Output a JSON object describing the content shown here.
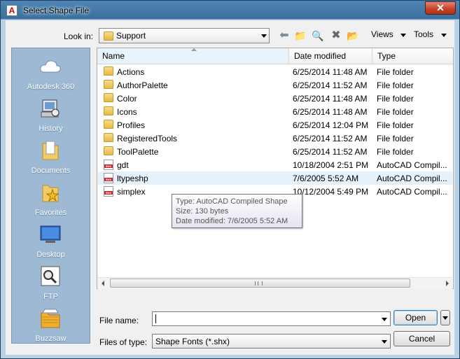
{
  "window": {
    "title": "Select Shape File",
    "app_icon": "A"
  },
  "toolbar": {
    "look_in_label": "Look in:",
    "look_in_value": "Support",
    "views_label": "Views",
    "tools_label": "Tools",
    "icons": [
      "back-icon",
      "up-folder-icon",
      "search-web-icon",
      "delete-icon",
      "create-folder-icon"
    ]
  },
  "places": [
    {
      "label": "Autodesk 360",
      "icon": "cloud-icon"
    },
    {
      "label": "History",
      "icon": "history-icon"
    },
    {
      "label": "Documents",
      "icon": "documents-icon"
    },
    {
      "label": "Favorites",
      "icon": "favorites-icon"
    },
    {
      "label": "Desktop",
      "icon": "desktop-icon"
    },
    {
      "label": "FTP",
      "icon": "ftp-icon"
    },
    {
      "label": "Buzzsaw",
      "icon": "buzzsaw-icon"
    }
  ],
  "file_list": {
    "columns": {
      "name": "Name",
      "date": "Date modified",
      "type": "Type"
    },
    "rows": [
      {
        "name": "Actions",
        "date": "6/25/2014 11:48 AM",
        "type": "File folder",
        "kind": "folder"
      },
      {
        "name": "AuthorPalette",
        "date": "6/25/2014 11:52 AM",
        "type": "File folder",
        "kind": "folder"
      },
      {
        "name": "Color",
        "date": "6/25/2014 11:48 AM",
        "type": "File folder",
        "kind": "folder"
      },
      {
        "name": "Icons",
        "date": "6/25/2014 11:48 AM",
        "type": "File folder",
        "kind": "folder"
      },
      {
        "name": "Profiles",
        "date": "6/25/2014 12:04 PM",
        "type": "File folder",
        "kind": "folder"
      },
      {
        "name": "RegisteredTools",
        "date": "6/25/2014 11:52 AM",
        "type": "File folder",
        "kind": "folder"
      },
      {
        "name": "ToolPalette",
        "date": "6/25/2014 11:52 AM",
        "type": "File folder",
        "kind": "folder"
      },
      {
        "name": "gdt",
        "date": "10/18/2004 2:51 PM",
        "type": "AutoCAD Compil...",
        "kind": "shx"
      },
      {
        "name": "ltypeshp",
        "date": "7/6/2005 5:52 AM",
        "type": "AutoCAD Compil...",
        "kind": "shx"
      },
      {
        "name": "simplex",
        "date": "10/12/2004 5:49 PM",
        "type": "AutoCAD Compil...",
        "kind": "shx"
      }
    ]
  },
  "tooltip": {
    "type_line": "Type: AutoCAD Compiled Shape",
    "size_line": "Size: 130 bytes",
    "date_line": "Date modified: 7/6/2005 5:52 AM"
  },
  "footer": {
    "file_name_label": "File name:",
    "file_name_value": "",
    "files_of_type_label": "Files of type:",
    "files_of_type_value": "Shape Fonts (*.shx)",
    "open_label": "Open",
    "cancel_label": "Cancel"
  },
  "colors": {
    "sidebar": "#9db9d4",
    "hover_row": "#e5f1fb",
    "close_button": "#c7432a"
  }
}
